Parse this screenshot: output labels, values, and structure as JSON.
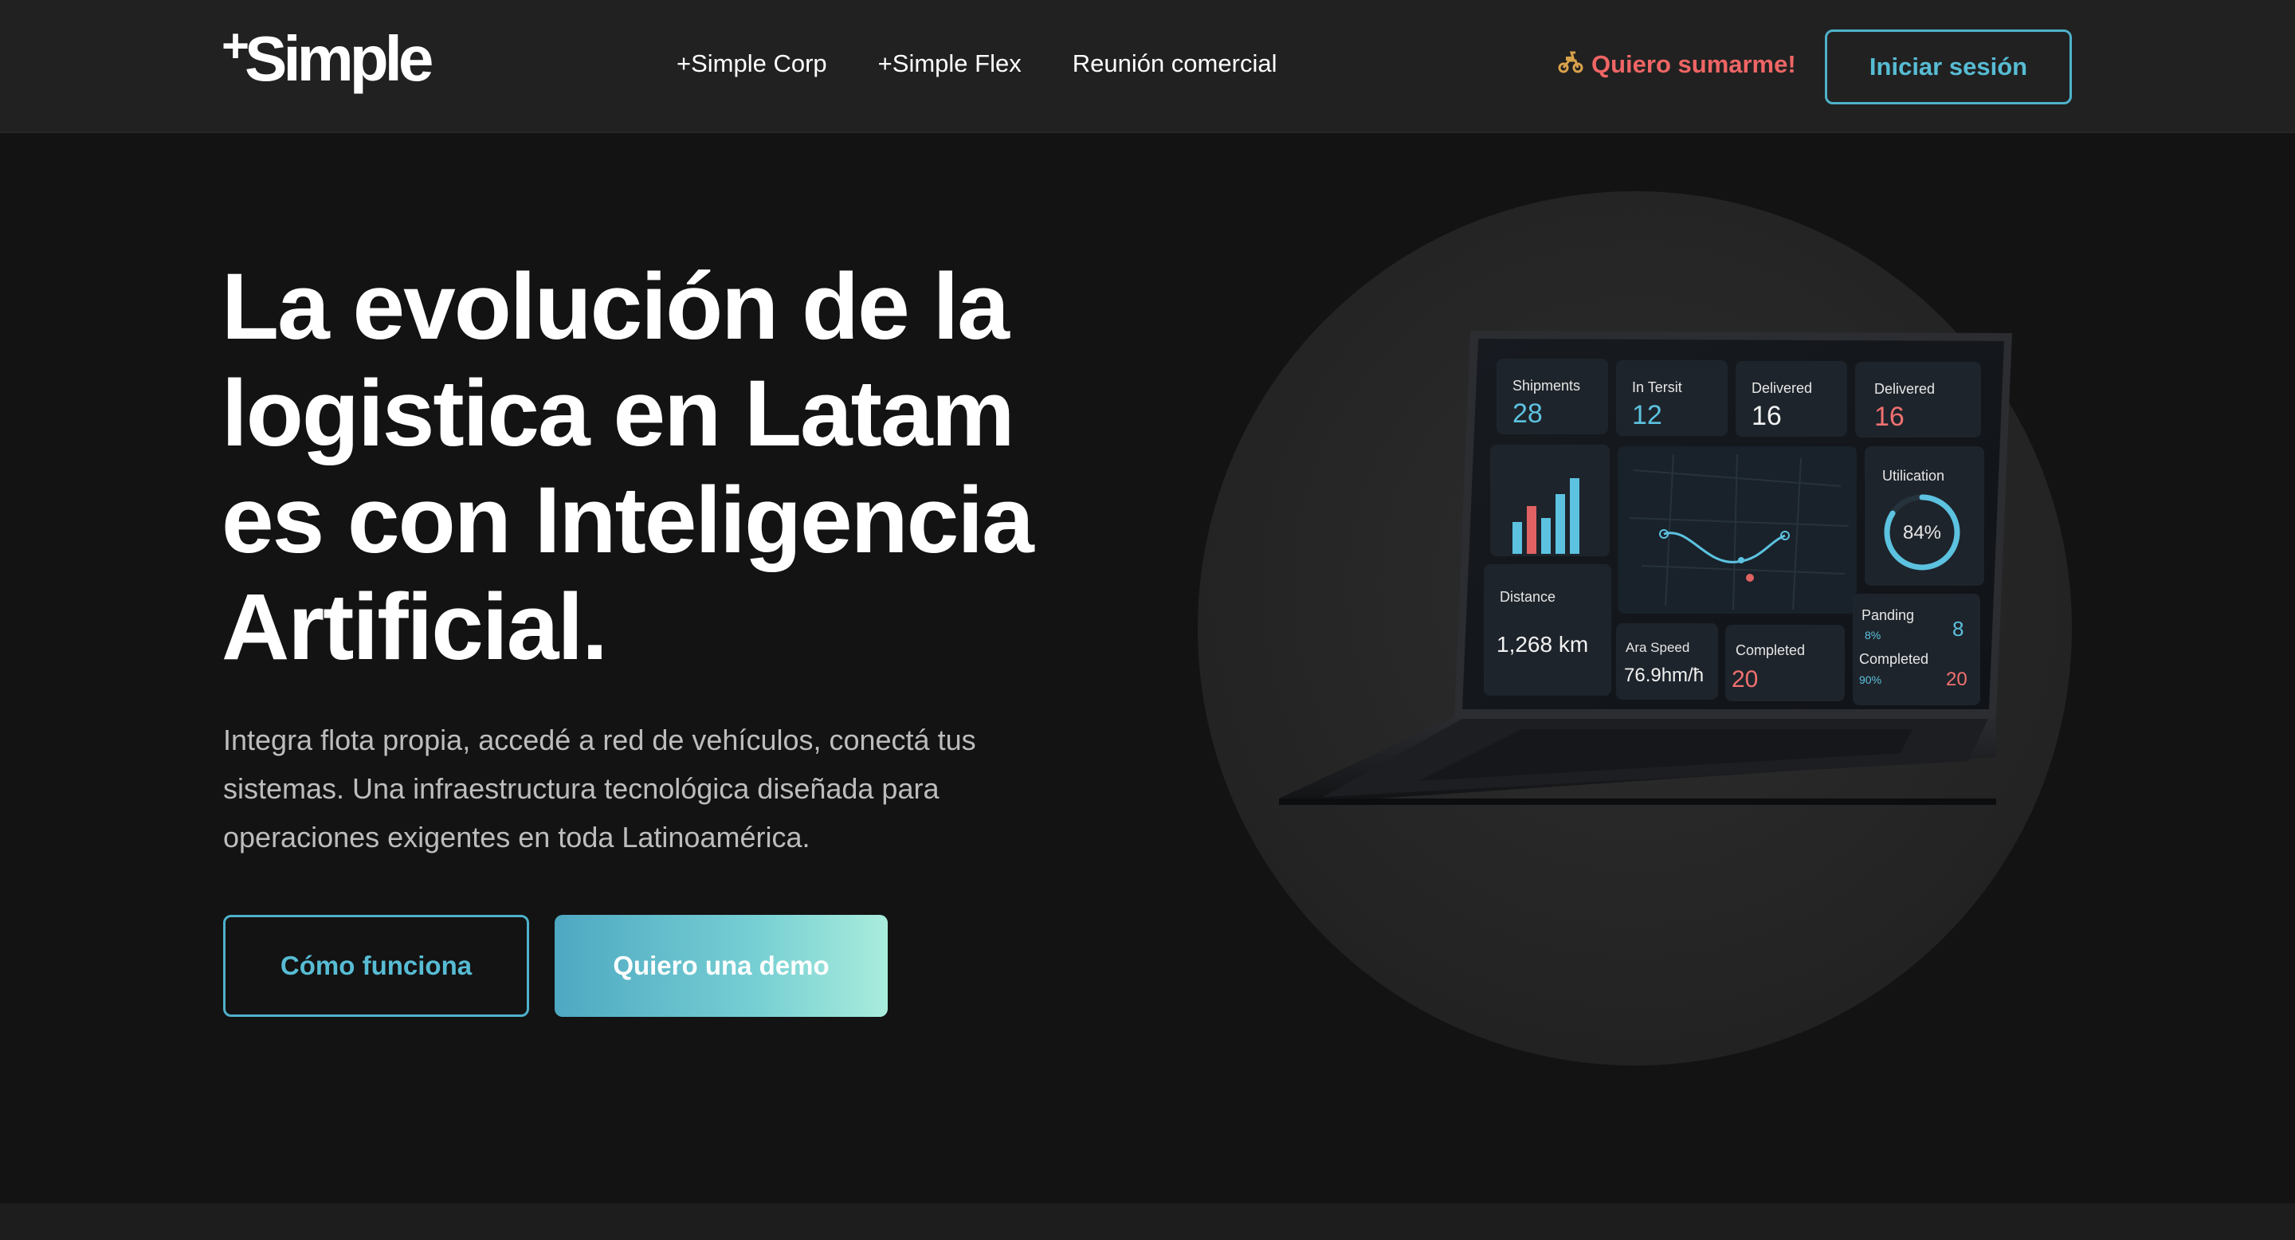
{
  "header": {
    "logo_plus": "+",
    "logo_word": "Simple",
    "nav": [
      "+Simple Corp",
      "+Simple Flex",
      "Reunión comercial"
    ],
    "join_icon": "scooter-icon",
    "join_label": "Quiero sumarme!",
    "login_label": "Iniciar sesión"
  },
  "hero": {
    "headline_lines": [
      "La evolución de la",
      "logistica en Latam",
      "es con Inteligencia",
      "Artificial."
    ],
    "subtext_lines": [
      "Integra flota propia, accedé a red de vehículos, conectá tus",
      "sistemas. Una infraestructura tecnológica diseñada para",
      "operaciones exigentes en toda Latinoamérica."
    ],
    "btn_secondary": "Cómo funciona",
    "btn_primary": "Quiero una demo"
  },
  "dashboard": {
    "cards": [
      {
        "label": "Shipments",
        "value": "28"
      },
      {
        "label": "In Tersit",
        "value": "12"
      },
      {
        "label": "Delivered",
        "value": "16"
      },
      {
        "label": "Delivered",
        "value": "16"
      }
    ],
    "utilization_label": "Utilication",
    "utilization_value": "84%",
    "utilization_fraction": 0.84,
    "distance_label": "Distance",
    "distance_value": "1,268 km",
    "speed_label": "Ara Speed",
    "speed_value": "76.9hm/ħ",
    "completed_label": "Completed",
    "completed_value": "20",
    "pending_label": "Panding",
    "pending_pct": "8%",
    "pending_value": "8",
    "completed2_label": "Completed",
    "completed2_pct": "90%",
    "completed2_value": "20"
  },
  "colors": {
    "accent": "#4fb2cb",
    "join": "#f06565",
    "background": "#131313",
    "header": "#212121"
  }
}
